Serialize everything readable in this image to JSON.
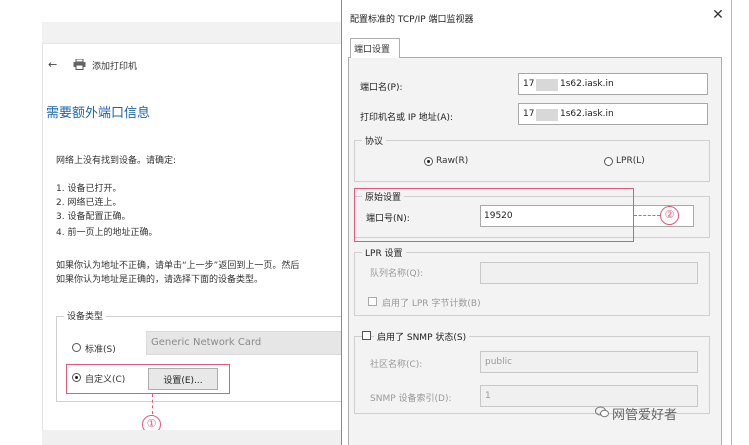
{
  "wizard": {
    "back_glyph": "←",
    "title": "添加打印机",
    "heading": "需要额外端口信息",
    "check_intro": "网络上没有找到设备。请确定:",
    "check_items": [
      "1.  设备已打开。",
      "2.  网络已连上。",
      "3.  设备配置正确。",
      "4.  前一页上的地址正确。"
    ],
    "para1": "如果你认为地址不正确，请单击“上一步”返回到上一页。然后",
    "para2": "如果你认为地址是正确的，请选择下面的设备类型。",
    "device_type": {
      "label": "设备类型",
      "standard_label": "标准(S)",
      "standard_value": "Generic Network Card",
      "custom_label": "自定义(C)",
      "settings_button": "设置(E)...",
      "selected": "custom"
    },
    "callout_marker": "①"
  },
  "dialog": {
    "title": "配置标准的 TCP/IP 端口监视器",
    "close_glyph": "✕",
    "tab": "端口设置",
    "port_name_label": "端口名(P):",
    "port_name_value_prefix": "17",
    "port_name_value_suffix": "1s62.iask.in",
    "host_label": "打印机名或 IP 地址(A):",
    "host_value_prefix": "17",
    "host_value_suffix": "1s62.iask.in",
    "protocol": {
      "label": "协议",
      "raw_label": "Raw(R)",
      "lpr_label": "LPR(L)",
      "selected": "raw"
    },
    "raw_settings": {
      "label": "原始设置",
      "port_number_label": "端口号(N):",
      "port_number_value": "19520"
    },
    "lpr_settings": {
      "label": "LPR 设置",
      "queue_label": "队列名称(Q):",
      "byte_count_label": "启用了 LPR 字节计数(B)"
    },
    "snmp": {
      "label": "启用了 SNMP 状态(S)",
      "community_label": "社区名称(C):",
      "community_value": "public",
      "device_index_label": "SNMP 设备索引(D):",
      "device_index_value": "1"
    },
    "callout_marker": "②"
  },
  "watermark": "网管爱好者",
  "colors": {
    "accent_heading": "#1a64b4",
    "annotation": "#e05a7a"
  }
}
